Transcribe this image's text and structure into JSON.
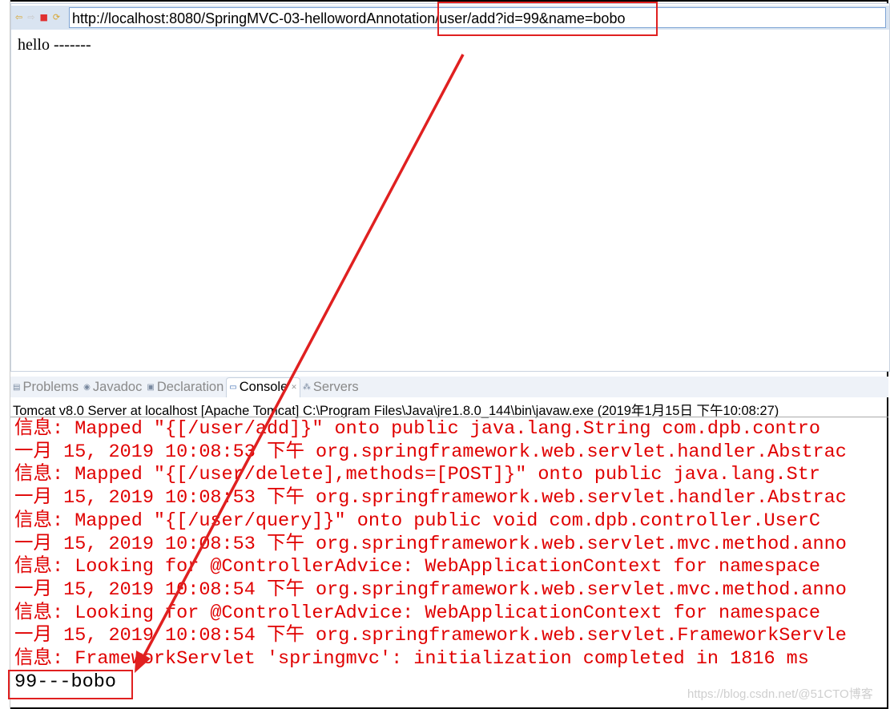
{
  "browser": {
    "url": "http://localhost:8080/SpringMVC-03-hellowordAnnotation/user/add?id=99&name=bobo",
    "page_text": "hello -------",
    "nav_icons": [
      "back-arrow-icon",
      "forward-arrow-icon",
      "stop-icon",
      "refresh-icon"
    ]
  },
  "tabs": [
    {
      "label": "Problems",
      "icon": "problems-icon",
      "active": false
    },
    {
      "label": "Javadoc",
      "icon": "javadoc-icon",
      "active": false
    },
    {
      "label": "Declaration",
      "icon": "declaration-icon",
      "active": false
    },
    {
      "label": "Console",
      "icon": "console-icon",
      "active": true
    },
    {
      "label": "Servers",
      "icon": "servers-icon",
      "active": false
    }
  ],
  "console": {
    "title": "Tomcat v8.0 Server at localhost [Apache Tomcat] C:\\Program Files\\Java\\jre1.8.0_144\\bin\\javaw.exe (2019年1月15日 下午10:08:27)",
    "lines": [
      "信息: Mapped \"{[/user/add]}\" onto public java.lang.String com.dpb.contro",
      "一月 15, 2019 10:08:53 下午 org.springframework.web.servlet.handler.Abstrac",
      "信息: Mapped \"{[/user/delete],methods=[POST]}\" onto public java.lang.Str",
      "一月 15, 2019 10:08:53 下午 org.springframework.web.servlet.handler.Abstrac",
      "信息: Mapped \"{[/user/query]}\" onto public void com.dpb.controller.UserC",
      "一月 15, 2019 10:08:53 下午 org.springframework.web.servlet.mvc.method.anno",
      "信息: Looking for @ControllerAdvice: WebApplicationContext for namespace",
      "一月 15, 2019 10:08:54 下午 org.springframework.web.servlet.mvc.method.anno",
      "信息: Looking for @ControllerAdvice: WebApplicationContext for namespace",
      "一月 15, 2019 10:08:54 下午 org.springframework.web.servlet.FrameworkServle",
      "信息: FrameworkServlet 'springmvc': initialization completed in 1816 ms"
    ],
    "output": "99---bobo"
  },
  "watermark": "https://blog.csdn.net/@51CTO博客",
  "colors": {
    "log_text": "#e00000",
    "annotation": "#e02020"
  }
}
